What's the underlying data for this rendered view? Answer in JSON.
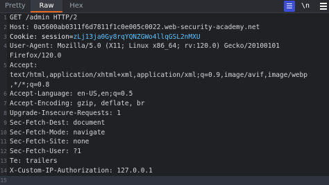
{
  "tabs": [
    {
      "label": "Pretty"
    },
    {
      "label": "Raw"
    },
    {
      "label": "Hex"
    }
  ],
  "toolbar": {
    "newline_label": "\\n"
  },
  "colors": {
    "accent": "#e66a1f",
    "active_icon_bg": "#3d4fd9",
    "highlight": "#5fc3ff"
  },
  "lines": [
    {
      "num": "1",
      "text": "GET /admin HTTP/2"
    },
    {
      "num": "2",
      "text": "Host: 0a5600ab0311f6d7811f1c0e005c0022.web-security-academy.net"
    },
    {
      "num": "3",
      "key": "Cookie: session=",
      "value": "zLj13ja0Gy8rqYQNZGWo4llqGSL2nMXU"
    },
    {
      "num": "4",
      "text": "User-Agent: Mozilla/5.0 (X11; Linux x86_64; rv:120.0) Gecko/20100101"
    },
    {
      "num": "",
      "text": "Firefox/120.0"
    },
    {
      "num": "5",
      "text": "Accept:"
    },
    {
      "num": "",
      "text": "text/html,application/xhtml+xml,application/xml;q=0.9,image/avif,image/webp"
    },
    {
      "num": "",
      "text": ",*/*;q=0.8"
    },
    {
      "num": "6",
      "text": "Accept-Language: en-US,en;q=0.5"
    },
    {
      "num": "7",
      "text": "Accept-Encoding: gzip, deflate, br"
    },
    {
      "num": "8",
      "text": "Upgrade-Insecure-Requests: 1"
    },
    {
      "num": "9",
      "text": "Sec-Fetch-Dest: document"
    },
    {
      "num": "10",
      "text": "Sec-Fetch-Mode: navigate"
    },
    {
      "num": "11",
      "text": "Sec-Fetch-Site: none"
    },
    {
      "num": "12",
      "text": "Sec-Fetch-User: ?1"
    },
    {
      "num": "13",
      "text": "Te: trailers"
    },
    {
      "num": "14",
      "text": "X-Custom-IP-Authorization: 127.0.0.1"
    },
    {
      "num": "15",
      "text": ""
    }
  ]
}
